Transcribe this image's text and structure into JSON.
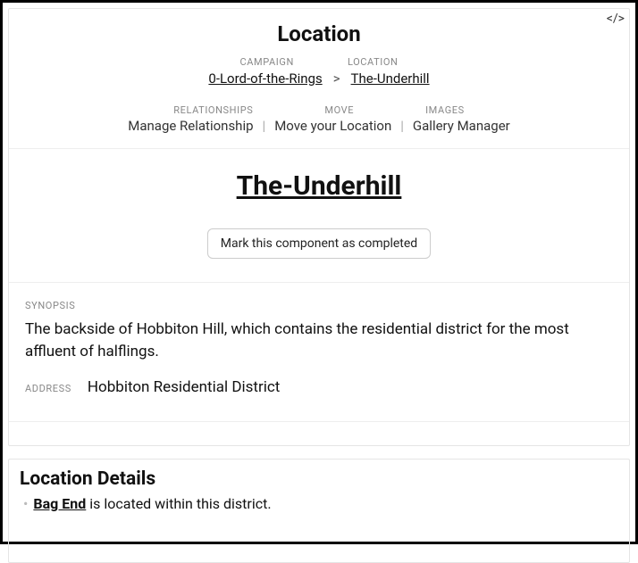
{
  "header": {
    "page_title": "Location",
    "breadcrumb": {
      "campaign_label": "Campaign",
      "campaign_link": "0-Lord-of-the-Rings",
      "separator": ">",
      "location_label": "Location",
      "location_link": "The-Underhill"
    },
    "actions": {
      "relationships_label": "Relationships",
      "relationships_link": "Manage Relationship",
      "move_label": "Move",
      "move_link": "Move your Location",
      "images_label": "Images",
      "images_link": "Gallery Manager"
    }
  },
  "item": {
    "title": "The-Underhill",
    "complete_button": "Mark this component as completed"
  },
  "fields": {
    "synopsis_label": "Synopsis",
    "synopsis_text": "The backside of Hobbiton Hill, which contains the residential district for the most affluent of halflings.",
    "address_label": "Address",
    "address_value": "Hobbiton Residential District"
  },
  "details": {
    "heading": "Location Details",
    "bullet_link": "Bag End",
    "bullet_rest": " is located within this district."
  }
}
